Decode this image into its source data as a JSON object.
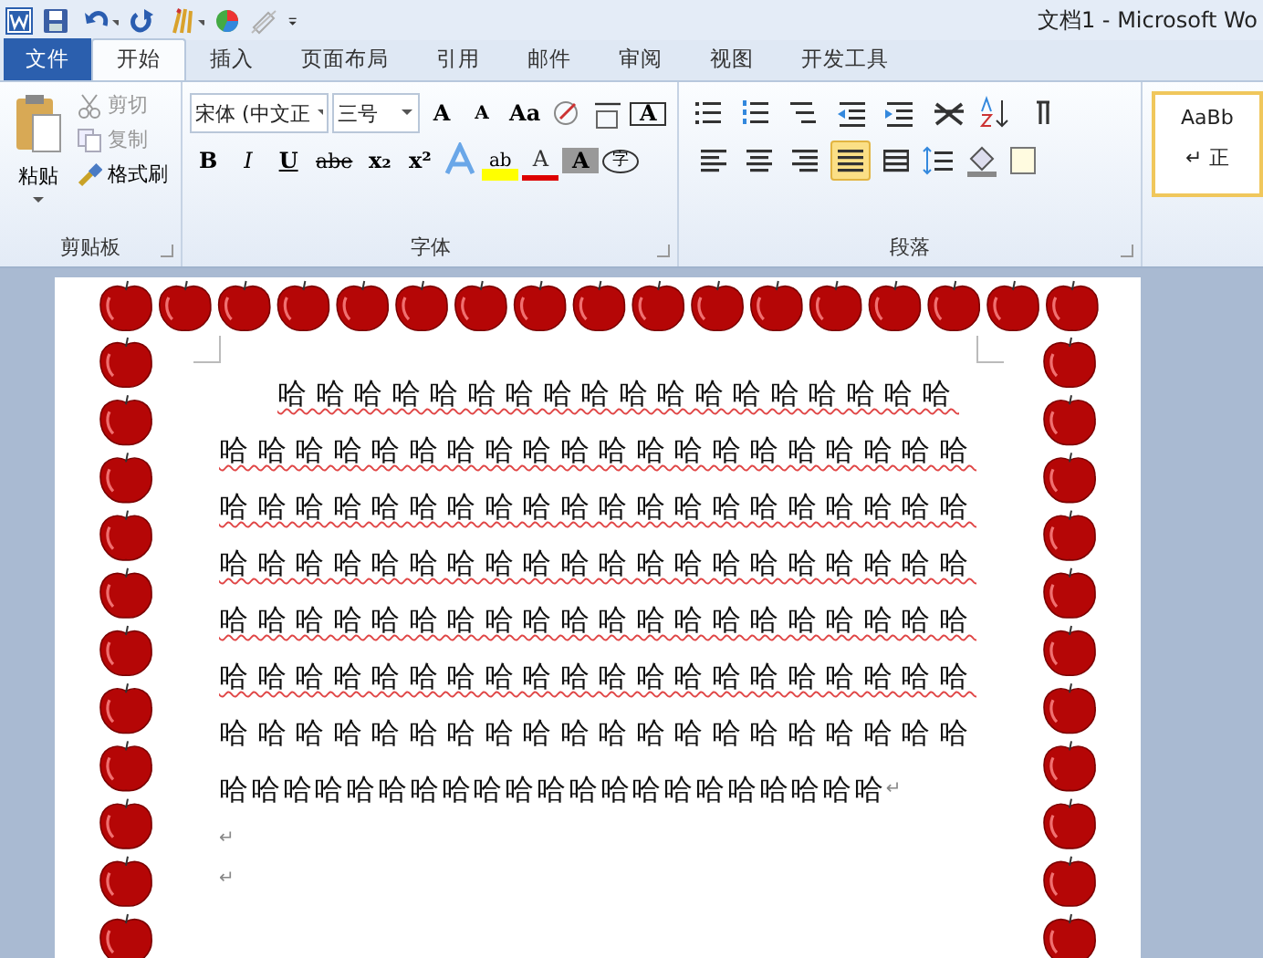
{
  "window": {
    "title": "文档1 - Microsoft Wo"
  },
  "tabs": [
    {
      "label": "文件",
      "kind": "file",
      "selected": false
    },
    {
      "label": "开始",
      "kind": "tab",
      "selected": true
    },
    {
      "label": "插入",
      "kind": "tab",
      "selected": false
    },
    {
      "label": "页面布局",
      "kind": "tab",
      "selected": false
    },
    {
      "label": "引用",
      "kind": "tab",
      "selected": false
    },
    {
      "label": "邮件",
      "kind": "tab",
      "selected": false
    },
    {
      "label": "审阅",
      "kind": "tab",
      "selected": false
    },
    {
      "label": "视图",
      "kind": "tab",
      "selected": false
    },
    {
      "label": "开发工具",
      "kind": "tab",
      "selected": false
    }
  ],
  "clipboard": {
    "label": "剪贴板",
    "paste": "粘贴",
    "cut": "剪切",
    "copy": "复制",
    "format_painter": "格式刷"
  },
  "font": {
    "label": "字体",
    "font_name": "宋体 (中文正",
    "font_size": "三号",
    "grow": "A",
    "shrink": "A",
    "change_case": "Aa",
    "bold": "B",
    "italic": "I",
    "underline": "U",
    "strikethrough": "abe",
    "subscript": "x₂",
    "superscript": "x²",
    "highlight": "ab",
    "font_color": "A",
    "shading": "A",
    "border": "A",
    "enclosed": "字"
  },
  "paragraph": {
    "label": "段落",
    "alignments": [
      {
        "kind": "left",
        "selected": false
      },
      {
        "kind": "center",
        "selected": false
      },
      {
        "kind": "right",
        "selected": false
      },
      {
        "kind": "justify",
        "selected": true
      },
      {
        "kind": "distributed",
        "selected": false
      }
    ]
  },
  "styles": {
    "preview": "AaBb",
    "caption": "↵ 正"
  },
  "document": {
    "lines": [
      {
        "text": "哈哈哈哈哈哈哈哈哈哈哈哈哈哈哈哈哈哈",
        "kind": "indented",
        "underlined": true
      },
      {
        "text": "哈哈哈哈哈哈哈哈哈哈哈哈哈哈哈哈哈哈哈哈",
        "kind": "normal",
        "underlined": true
      },
      {
        "text": "哈哈哈哈哈哈哈哈哈哈哈哈哈哈哈哈哈哈哈哈",
        "kind": "normal",
        "underlined": true
      },
      {
        "text": "哈哈哈哈哈哈哈哈哈哈哈哈哈哈哈哈哈哈哈哈",
        "kind": "normal",
        "underlined": true
      },
      {
        "text": "哈哈哈哈哈哈哈哈哈哈哈哈哈哈哈哈哈哈哈哈",
        "kind": "normal",
        "underlined": true
      },
      {
        "text": "哈哈哈哈哈哈哈哈哈哈哈哈哈哈哈哈哈哈哈哈",
        "kind": "normal",
        "underlined": true
      },
      {
        "text": "哈哈哈哈哈哈哈哈哈哈哈哈哈哈哈哈哈哈哈哈",
        "kind": "normal",
        "underlined": false
      },
      {
        "text": "哈哈哈哈哈哈哈哈哈哈哈哈哈哈哈哈哈哈哈哈哈",
        "kind": "tight",
        "underlined": false,
        "end_mark": "↵"
      }
    ],
    "empty_paragraphs": [
      "↵",
      "↵"
    ]
  }
}
